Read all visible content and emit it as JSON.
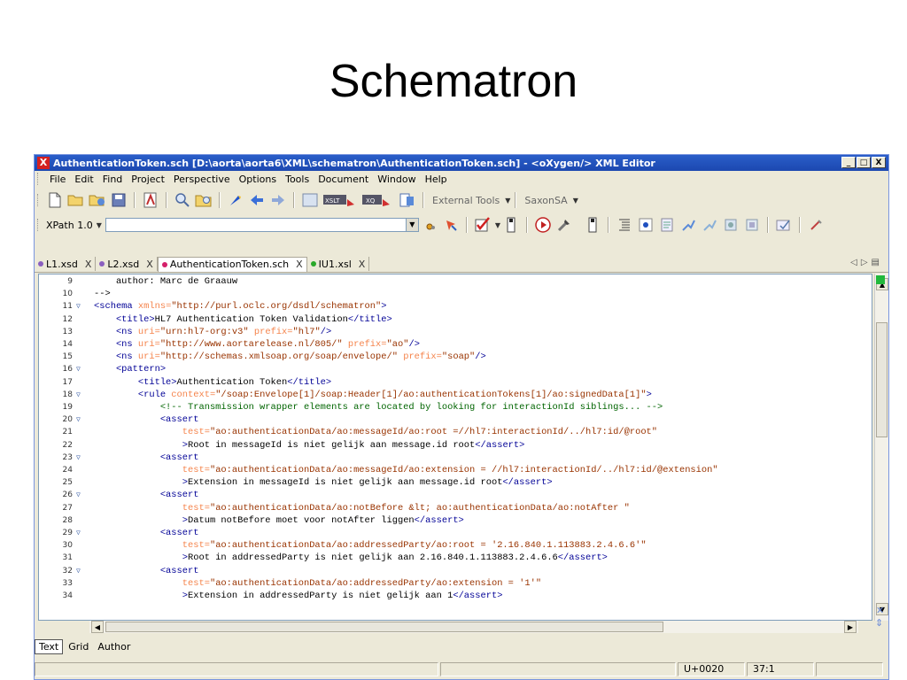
{
  "slide": {
    "title": "Schematron"
  },
  "window": {
    "title": "AuthenticationToken.sch [D:\\aorta\\aorta6\\XML\\schematron\\AuthenticationToken.sch] - <oXygen/> XML Editor",
    "controls": {
      "minimize": "_",
      "maximize": "□",
      "close": "X"
    }
  },
  "menu": [
    "File",
    "Edit",
    "Find",
    "Project",
    "Perspective",
    "Options",
    "Tools",
    "Document",
    "Window",
    "Help"
  ],
  "toolbar": {
    "external_tools": "External Tools",
    "saxon": "SaxonSA",
    "xslt_label": "XSLT",
    "xq_label": "XQ",
    "xpath_version": "XPath 1.0"
  },
  "tabs": [
    {
      "label": "L1.xsd",
      "color": "#8a5fbf",
      "close": "X"
    },
    {
      "label": "L2.xsd",
      "color": "#8a5fbf",
      "close": "X"
    },
    {
      "label": "AuthenticationToken.sch",
      "color": "#d4206a",
      "close": "X"
    },
    {
      "label": "IU1.xsl",
      "color": "#2aa82a",
      "close": "X"
    }
  ],
  "code_lines": [
    {
      "n": "9",
      "fold": "",
      "segs": [
        [
          "t",
          "    author: Marc de Graauw"
        ]
      ]
    },
    {
      "n": "10",
      "fold": "",
      "segs": [
        [
          "t",
          "-->"
        ]
      ]
    },
    {
      "n": "11",
      "fold": "▽",
      "segs": [
        [
          "g",
          "<schema "
        ],
        [
          "a",
          "xmlns="
        ],
        [
          "v",
          "\"http://purl.oclc.org/dsdl/schematron\""
        ],
        [
          "g",
          ">"
        ]
      ]
    },
    {
      "n": "12",
      "fold": "",
      "segs": [
        [
          "g",
          "    <title>"
        ],
        [
          "t",
          "HL7 Authentication Token Validation"
        ],
        [
          "g",
          "</title>"
        ]
      ]
    },
    {
      "n": "13",
      "fold": "",
      "segs": [
        [
          "g",
          "    <ns "
        ],
        [
          "a",
          "uri="
        ],
        [
          "v",
          "\"urn:hl7-org:v3\""
        ],
        [
          "a",
          " prefix="
        ],
        [
          "v",
          "\"hl7\""
        ],
        [
          "g",
          "/>"
        ]
      ]
    },
    {
      "n": "14",
      "fold": "",
      "segs": [
        [
          "g",
          "    <ns "
        ],
        [
          "a",
          "uri="
        ],
        [
          "v",
          "\"http://www.aortarelease.nl/805/\""
        ],
        [
          "a",
          " prefix="
        ],
        [
          "v",
          "\"ao\""
        ],
        [
          "g",
          "/>"
        ]
      ]
    },
    {
      "n": "15",
      "fold": "",
      "segs": [
        [
          "g",
          "    <ns "
        ],
        [
          "a",
          "uri="
        ],
        [
          "v",
          "\"http://schemas.xmlsoap.org/soap/envelope/\""
        ],
        [
          "a",
          " prefix="
        ],
        [
          "v",
          "\"soap\""
        ],
        [
          "g",
          "/>"
        ]
      ]
    },
    {
      "n": "16",
      "fold": "▽",
      "segs": [
        [
          "g",
          "    <pattern>"
        ]
      ]
    },
    {
      "n": "17",
      "fold": "",
      "segs": [
        [
          "g",
          "        <title>"
        ],
        [
          "t",
          "Authentication Token"
        ],
        [
          "g",
          "</title>"
        ]
      ]
    },
    {
      "n": "18",
      "fold": "▽",
      "segs": [
        [
          "g",
          "        <rule "
        ],
        [
          "a",
          "context="
        ],
        [
          "v",
          "\"/soap:Envelope[1]/soap:Header[1]/ao:authenticationTokens[1]/ao:signedData[1]\""
        ],
        [
          "g",
          ">"
        ]
      ]
    },
    {
      "n": "19",
      "fold": "",
      "segs": [
        [
          "c",
          "            <!-- Transmission wrapper elements are located by looking for interactionId siblings... -->"
        ]
      ]
    },
    {
      "n": "20",
      "fold": "▽",
      "segs": [
        [
          "g",
          "            <assert"
        ]
      ]
    },
    {
      "n": "21",
      "fold": "",
      "segs": [
        [
          "a",
          "                test="
        ],
        [
          "v",
          "\"ao:authenticationData/ao:messageId/ao:root =//hl7:interactionId/../hl7:id/@root\""
        ]
      ]
    },
    {
      "n": "22",
      "fold": "",
      "segs": [
        [
          "g",
          "                >"
        ],
        [
          "t",
          "Root in messageId is niet gelijk aan message.id root"
        ],
        [
          "g",
          "</assert>"
        ]
      ]
    },
    {
      "n": "23",
      "fold": "▽",
      "segs": [
        [
          "g",
          "            <assert"
        ]
      ]
    },
    {
      "n": "24",
      "fold": "",
      "segs": [
        [
          "a",
          "                test="
        ],
        [
          "v",
          "\"ao:authenticationData/ao:messageId/ao:extension = //hl7:interactionId/../hl7:id/@extension\""
        ]
      ]
    },
    {
      "n": "25",
      "fold": "",
      "segs": [
        [
          "g",
          "                >"
        ],
        [
          "t",
          "Extension in messageId is niet gelijk aan message.id root"
        ],
        [
          "g",
          "</assert>"
        ]
      ]
    },
    {
      "n": "26",
      "fold": "▽",
      "segs": [
        [
          "g",
          "            <assert"
        ]
      ]
    },
    {
      "n": "27",
      "fold": "",
      "segs": [
        [
          "a",
          "                test="
        ],
        [
          "v",
          "\"ao:authenticationData/ao:notBefore &lt; ao:authenticationData/ao:notAfter \""
        ]
      ]
    },
    {
      "n": "28",
      "fold": "",
      "segs": [
        [
          "g",
          "                >"
        ],
        [
          "t",
          "Datum notBefore moet voor notAfter liggen"
        ],
        [
          "g",
          "</assert>"
        ]
      ]
    },
    {
      "n": "29",
      "fold": "▽",
      "segs": [
        [
          "g",
          "            <assert"
        ]
      ]
    },
    {
      "n": "30",
      "fold": "",
      "segs": [
        [
          "a",
          "                test="
        ],
        [
          "v",
          "\"ao:authenticationData/ao:addressedParty/ao:root = '2.16.840.1.113883.2.4.6.6'\""
        ]
      ]
    },
    {
      "n": "31",
      "fold": "",
      "segs": [
        [
          "g",
          "                >"
        ],
        [
          "t",
          "Root in addressedParty is niet gelijk aan 2.16.840.1.113883.2.4.6.6"
        ],
        [
          "g",
          "</assert>"
        ]
      ]
    },
    {
      "n": "32",
      "fold": "▽",
      "segs": [
        [
          "g",
          "            <assert"
        ]
      ]
    },
    {
      "n": "33",
      "fold": "",
      "segs": [
        [
          "a",
          "                test="
        ],
        [
          "v",
          "\"ao:authenticationData/ao:addressedParty/ao:extension = '1'\""
        ]
      ]
    },
    {
      "n": "34",
      "fold": "",
      "segs": [
        [
          "g",
          "                >"
        ],
        [
          "t",
          "Extension in addressedParty is niet gelijk aan 1"
        ],
        [
          "g",
          "</assert>"
        ]
      ]
    }
  ],
  "modes": [
    "Text",
    "Grid",
    "Author"
  ],
  "status": {
    "unicode": "U+0020",
    "position": "37:1"
  }
}
